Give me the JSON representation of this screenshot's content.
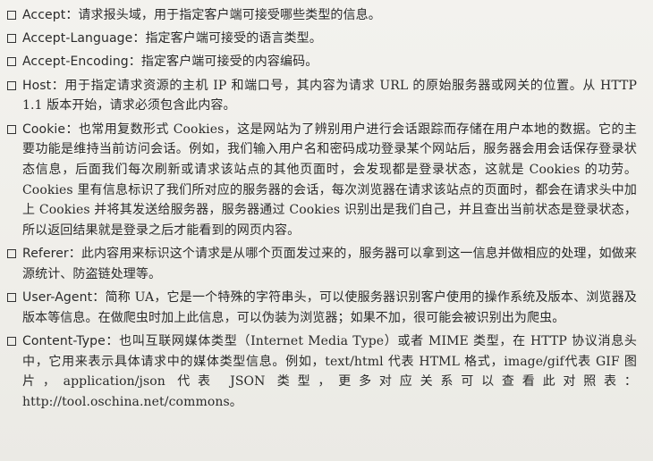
{
  "items": [
    {
      "term": "Accept",
      "text": "：请求报头域，用于指定客户端可接受哪些类型的信息。"
    },
    {
      "term": "Accept-Language",
      "text": "：指定客户端可接受的语言类型。"
    },
    {
      "term": "Accept-Encoding",
      "text": "：指定客户端可接受的内容编码。"
    },
    {
      "term": "Host",
      "text": "：用于指定请求资源的主机 IP 和端口号，其内容为请求 URL 的原始服务器或网关的位置。从 HTTP 1.1 版本开始，请求必须包含此内容。"
    },
    {
      "term": "Cookie",
      "text": "：也常用复数形式 Cookies，这是网站为了辨别用户进行会话跟踪而存储在用户本地的数据。它的主要功能是维持当前访问会话。例如，我们输入用户名和密码成功登录某个网站后，服务器会用会话保存登录状态信息，后面我们每次刷新或请求该站点的其他页面时，会发现都是登录状态，这就是 Cookies 的功劳。Cookies 里有信息标识了我们所对应的服务器的会话，每次浏览器在请求该站点的页面时，都会在请求头中加上 Cookies 并将其发送给服务器，服务器通过 Cookies 识别出是我们自己，并且查出当前状态是登录状态，所以返回结果就是登录之后才能看到的网页内容。"
    },
    {
      "term": "Referer",
      "text": "：此内容用来标识这个请求是从哪个页面发过来的，服务器可以拿到这一信息并做相应的处理，如做来源统计、防盗链处理等。"
    },
    {
      "term": "User-Agent",
      "text": "：简称 UA，它是一个特殊的字符串头，可以使服务器识别客户使用的操作系统及版本、浏览器及版本等信息。在做爬虫时加上此信息，可以伪装为浏览器；如果不加，很可能会被识别出为爬虫。"
    },
    {
      "term": "Content-Type",
      "text": "：也叫互联网媒体类型（Internet Media Type）或者 MIME 类型，在 HTTP 协议消息头中，它用来表示具体请求中的媒体类型信息。例如，text/html 代表 HTML 格式，image/gif代表 GIF 图片，application/json 代表 JSON 类型，更多对应关系可以查看此对照表：http://tool.oschina.net/commons。"
    }
  ]
}
